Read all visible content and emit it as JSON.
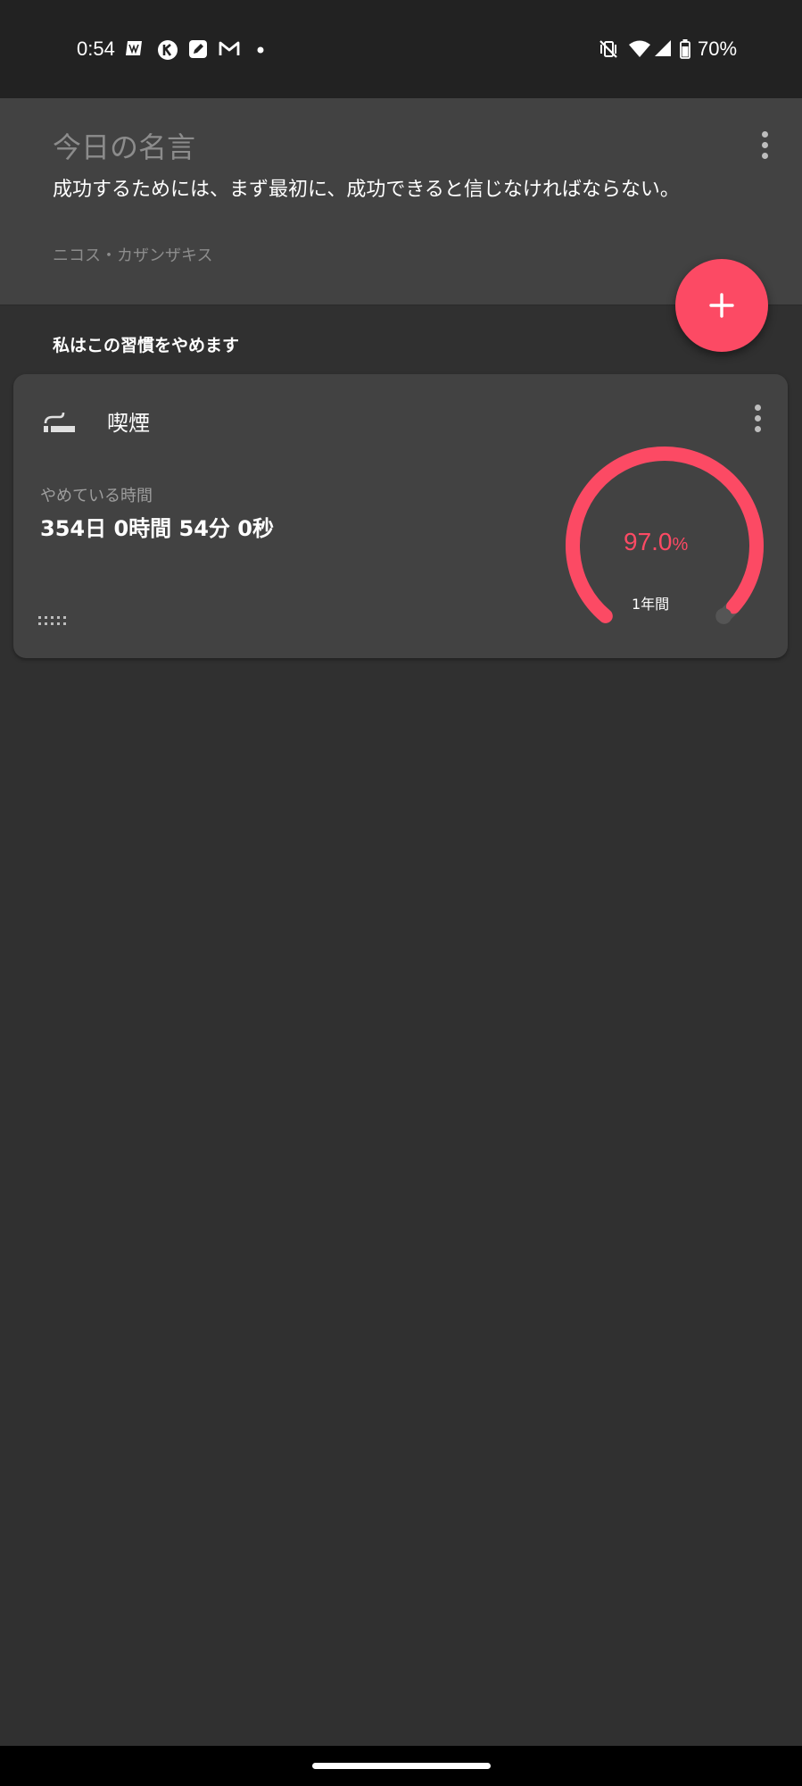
{
  "status_bar": {
    "time": "0:54",
    "battery_percent": "70%",
    "notification_icons": [
      "news-app-icon",
      "k-app-icon",
      "edit-app-icon",
      "gmail-icon",
      "more-dot-icon"
    ],
    "system_icons": [
      "vibrate-off-icon",
      "wifi-icon",
      "signal-icon",
      "battery-icon"
    ]
  },
  "quote": {
    "title": "今日の名言",
    "text": "成功するためには、まず最初に、成功できると信じなければならない。",
    "author": "ニコス・カザンザキス"
  },
  "habits_section": {
    "label": "私はこの習慣をやめます"
  },
  "habit_card": {
    "icon": "smoking-icon",
    "name": "喫煙",
    "elapsed_label": "やめている時間",
    "elapsed_value": "354日 0時間 54分 0秒",
    "progress_value": "97.0",
    "progress_unit": "%",
    "progress_fraction": 0.97,
    "goal_period": "1年間"
  },
  "colors": {
    "accent": "#fc4a64",
    "background": "#303030",
    "card": "#424242",
    "status_bar": "#222222"
  }
}
